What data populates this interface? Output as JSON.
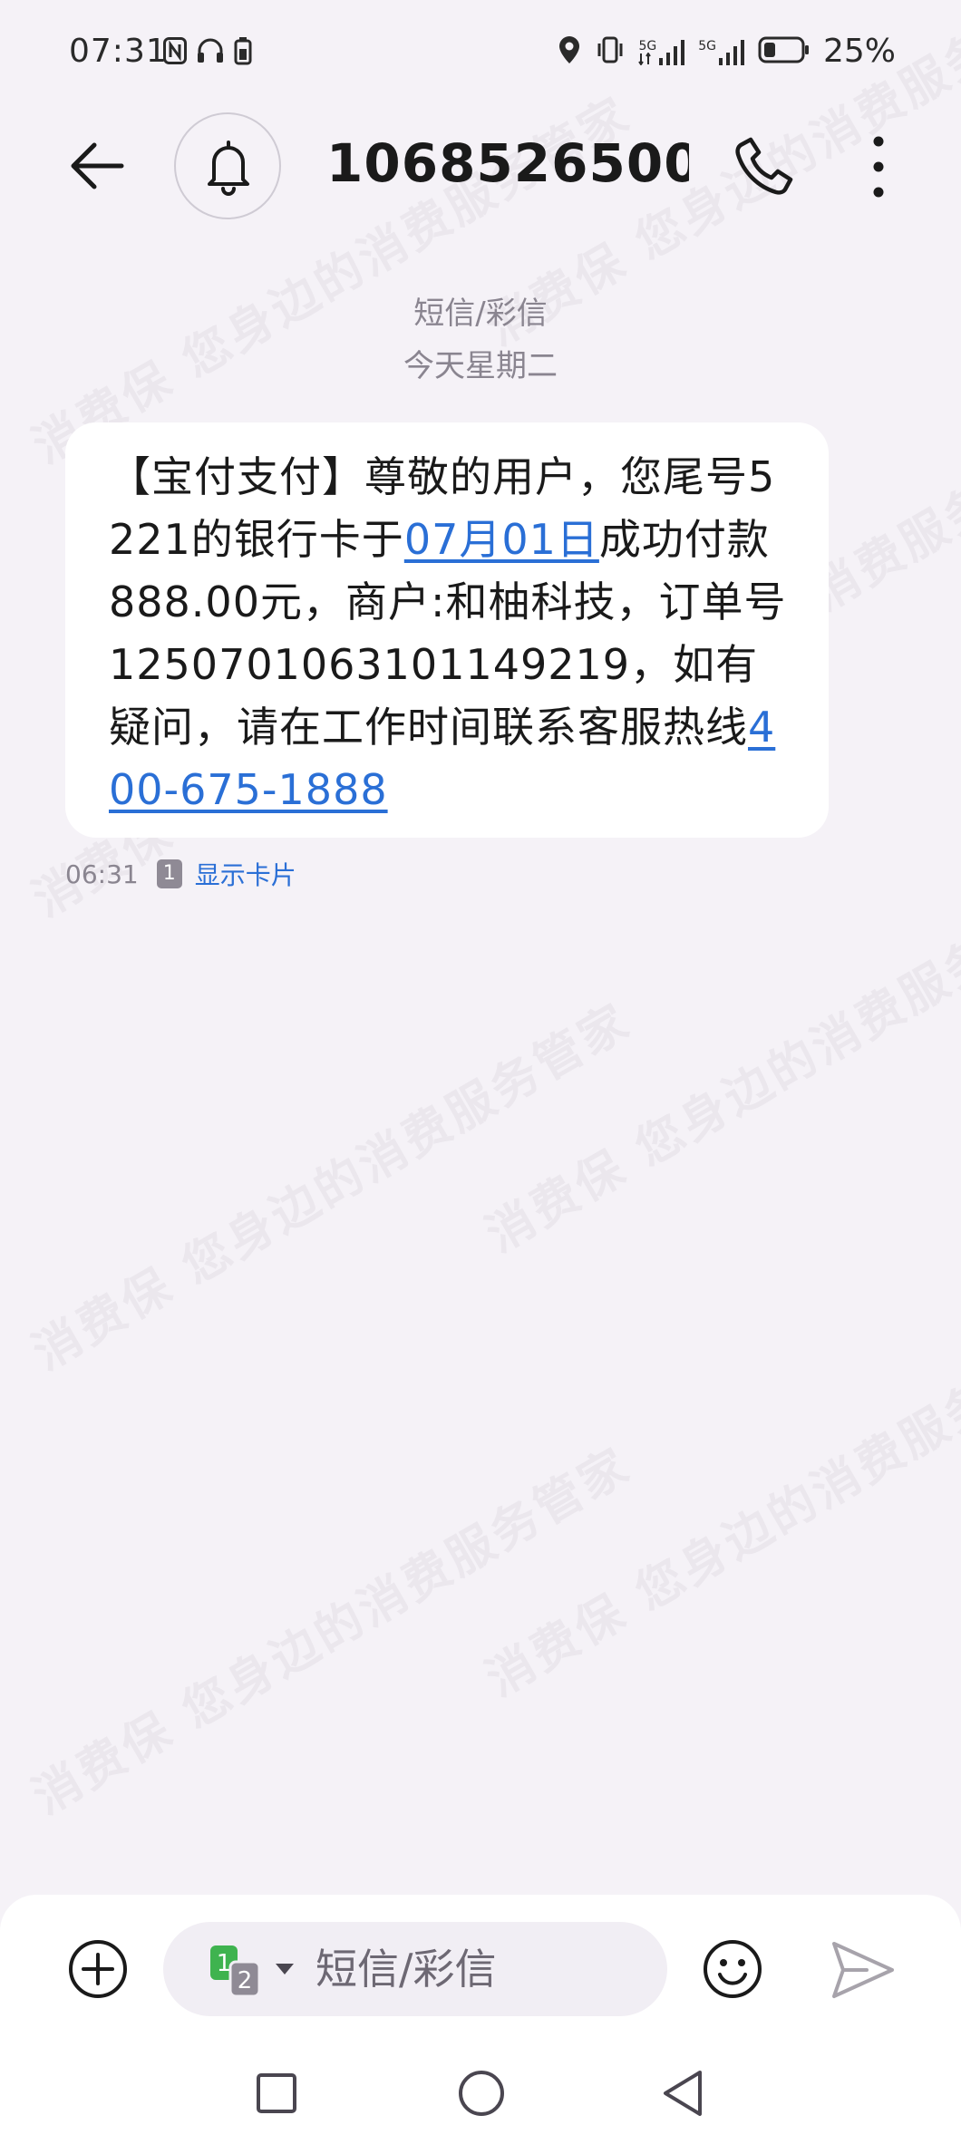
{
  "status_bar": {
    "time": "07:31",
    "battery_percent": "25%",
    "signal_1_label": "5G",
    "signal_2_label": "5G"
  },
  "header": {
    "contact": "1068526500..."
  },
  "conversation": {
    "sms_type": "短信/彩信",
    "date": "今天星期二"
  },
  "message": {
    "part1": "【宝付支付】尊敬的用户，您尾号5221的银行卡于",
    "date_link": "07月01日",
    "part2": "成功付款888.00元，商户:和柚科技，订单号1250701063101149219，如有疑问，请在工作时间联系客服热线",
    "phone_link": "400-675-1888",
    "time": "06:31",
    "sim_slot": "1",
    "show_card": "显示卡片"
  },
  "watermark": {
    "text": "消费保 您身边的消费服务管家"
  },
  "input": {
    "placeholder": "短信/彩信"
  },
  "colors": {
    "background": "#f5f2f7",
    "bubble": "#ffffff",
    "link": "#2a6fd6",
    "secondary_text": "#8a8590",
    "sim1": "#3fb34f",
    "sim2": "#8f8a95"
  }
}
